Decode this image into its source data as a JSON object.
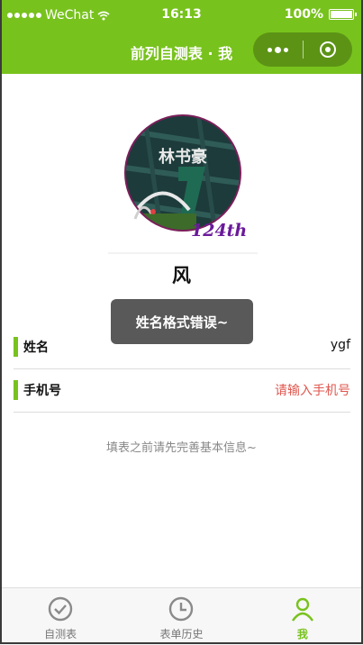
{
  "status_bar": {
    "carrier": "WeChat",
    "time": "16:13",
    "battery": "100%"
  },
  "nav": {
    "title": "前列自测表 · 我"
  },
  "profile": {
    "name": "风",
    "avatar_badge": "124th",
    "avatar_chars": "林书豪"
  },
  "toast": "姓名格式错误~",
  "form": {
    "name": {
      "label": "姓名",
      "value": "ygf"
    },
    "phone": {
      "label": "手机号",
      "placeholder": "请输入手机号"
    }
  },
  "hint": "填表之前请先完善基本信息~",
  "tabs": [
    {
      "label": "自测表",
      "icon": "check-circle-icon",
      "active": false
    },
    {
      "label": "表单历史",
      "icon": "clock-icon",
      "active": false
    },
    {
      "label": "我",
      "icon": "user-icon",
      "active": true
    }
  ],
  "colors": {
    "accent": "#78c21d",
    "placeholder": "#e0574f",
    "toast_bg": "#595959"
  }
}
